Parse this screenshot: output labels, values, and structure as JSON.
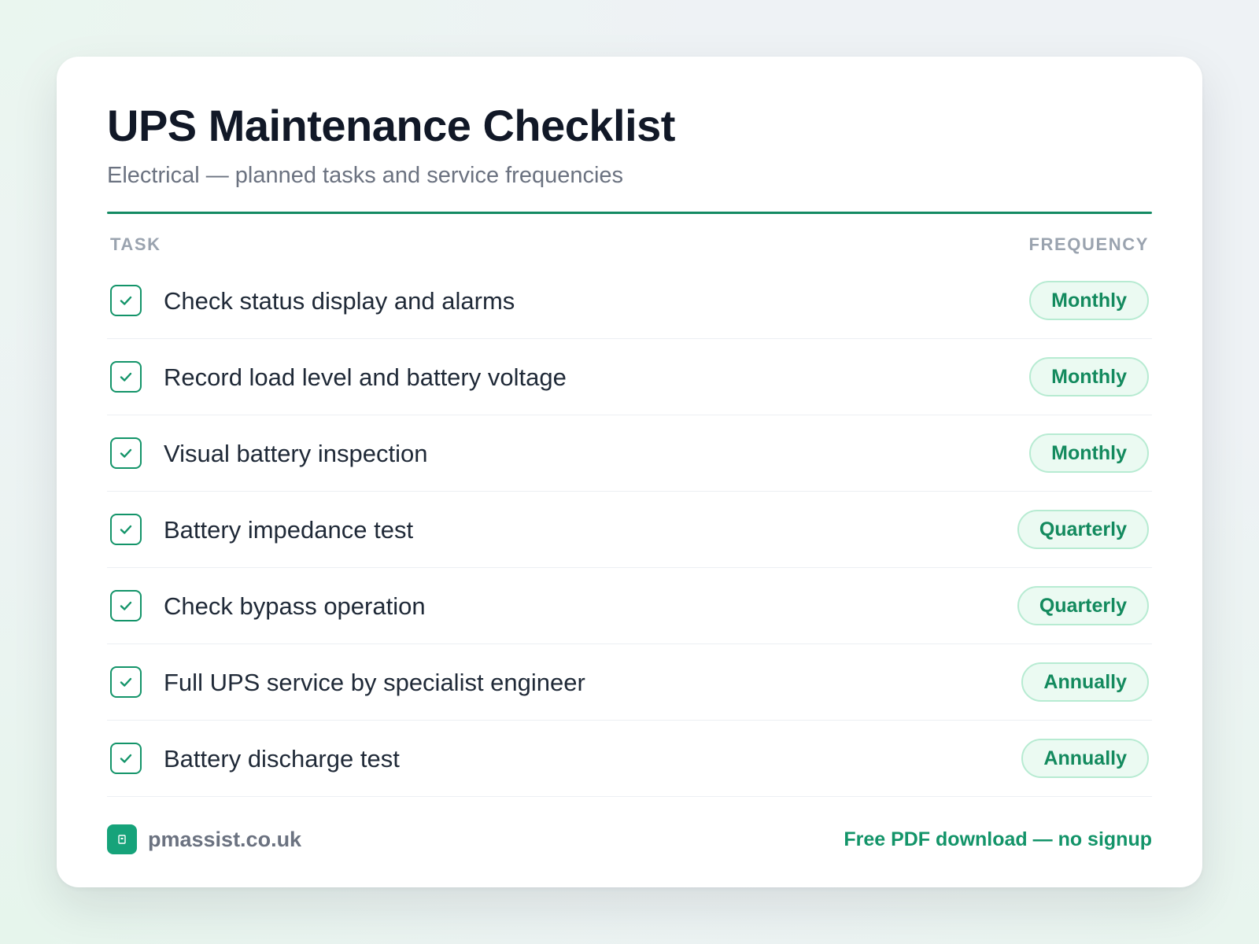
{
  "header": {
    "title": "UPS Maintenance Checklist",
    "subtitle": "Electrical — planned tasks and service frequencies"
  },
  "table": {
    "col_task": "TASK",
    "col_frequency": "FREQUENCY",
    "rows": [
      {
        "task": "Check status display and alarms",
        "frequency": "Monthly",
        "checked": true
      },
      {
        "task": "Record load level and battery voltage",
        "frequency": "Monthly",
        "checked": true
      },
      {
        "task": "Visual battery inspection",
        "frequency": "Monthly",
        "checked": true
      },
      {
        "task": "Battery impedance test",
        "frequency": "Quarterly",
        "checked": true
      },
      {
        "task": "Check bypass operation",
        "frequency": "Quarterly",
        "checked": true
      },
      {
        "task": "Full UPS service by specialist engineer",
        "frequency": "Annually",
        "checked": true
      },
      {
        "task": "Battery discharge test",
        "frequency": "Annually",
        "checked": true
      }
    ]
  },
  "footer": {
    "brand": "pmassist.co.uk",
    "brand_icon": "building-icon",
    "cta": "Free PDF download — no signup"
  },
  "colors": {
    "accent": "#139469",
    "badge_bg": "#ebfaf2",
    "badge_border": "#b7ebd2",
    "title": "#111827",
    "muted": "#6b7280"
  }
}
